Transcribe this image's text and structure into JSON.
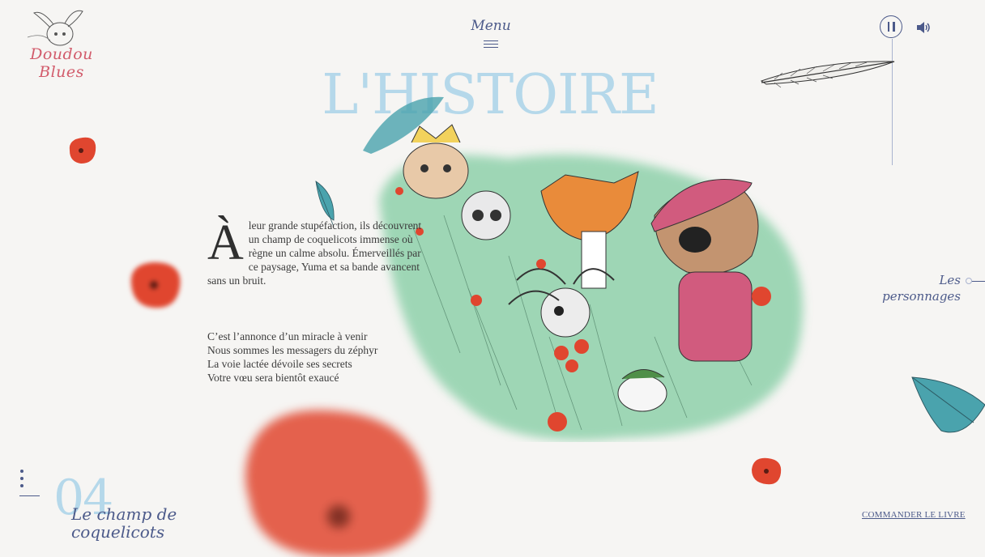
{
  "brand": {
    "logo_text_line1": "Doudou",
    "logo_text_line2": "Blues"
  },
  "header": {
    "menu_label": "Menu"
  },
  "audio": {
    "pause_icon": "pause-icon",
    "volume_icon": "volume-icon"
  },
  "page": {
    "title": "L'HISTOIRE"
  },
  "story": {
    "dropcap": "À",
    "paragraph": "leur grande stupéfaction, ils découvrent un champ de coquelicots immense où règne un calme absolu. Émerveillés par ce paysage, Yuma et sa bande avancent sans un bruit.",
    "poem": [
      "C’est l’annonce d’un miracle à venir",
      "Nous sommes les messagers du zéphyr",
      "La voie lactée dévoile ses secrets",
      "Votre vœu sera bientôt exaucé"
    ]
  },
  "nav": {
    "characters_line1": "Les",
    "characters_line2": "personnages"
  },
  "chapter": {
    "number": "04",
    "title_line1": "Le champ de",
    "title_line2": "coquelicots"
  },
  "footer": {
    "order_label": "COMMANDER LE LIVRE"
  },
  "colors": {
    "accent": "#4c5a8a",
    "title": "#b5d8ea",
    "poppy": "#e0462f",
    "feather": "#4aa3ad",
    "grass": "#6cc49a"
  }
}
